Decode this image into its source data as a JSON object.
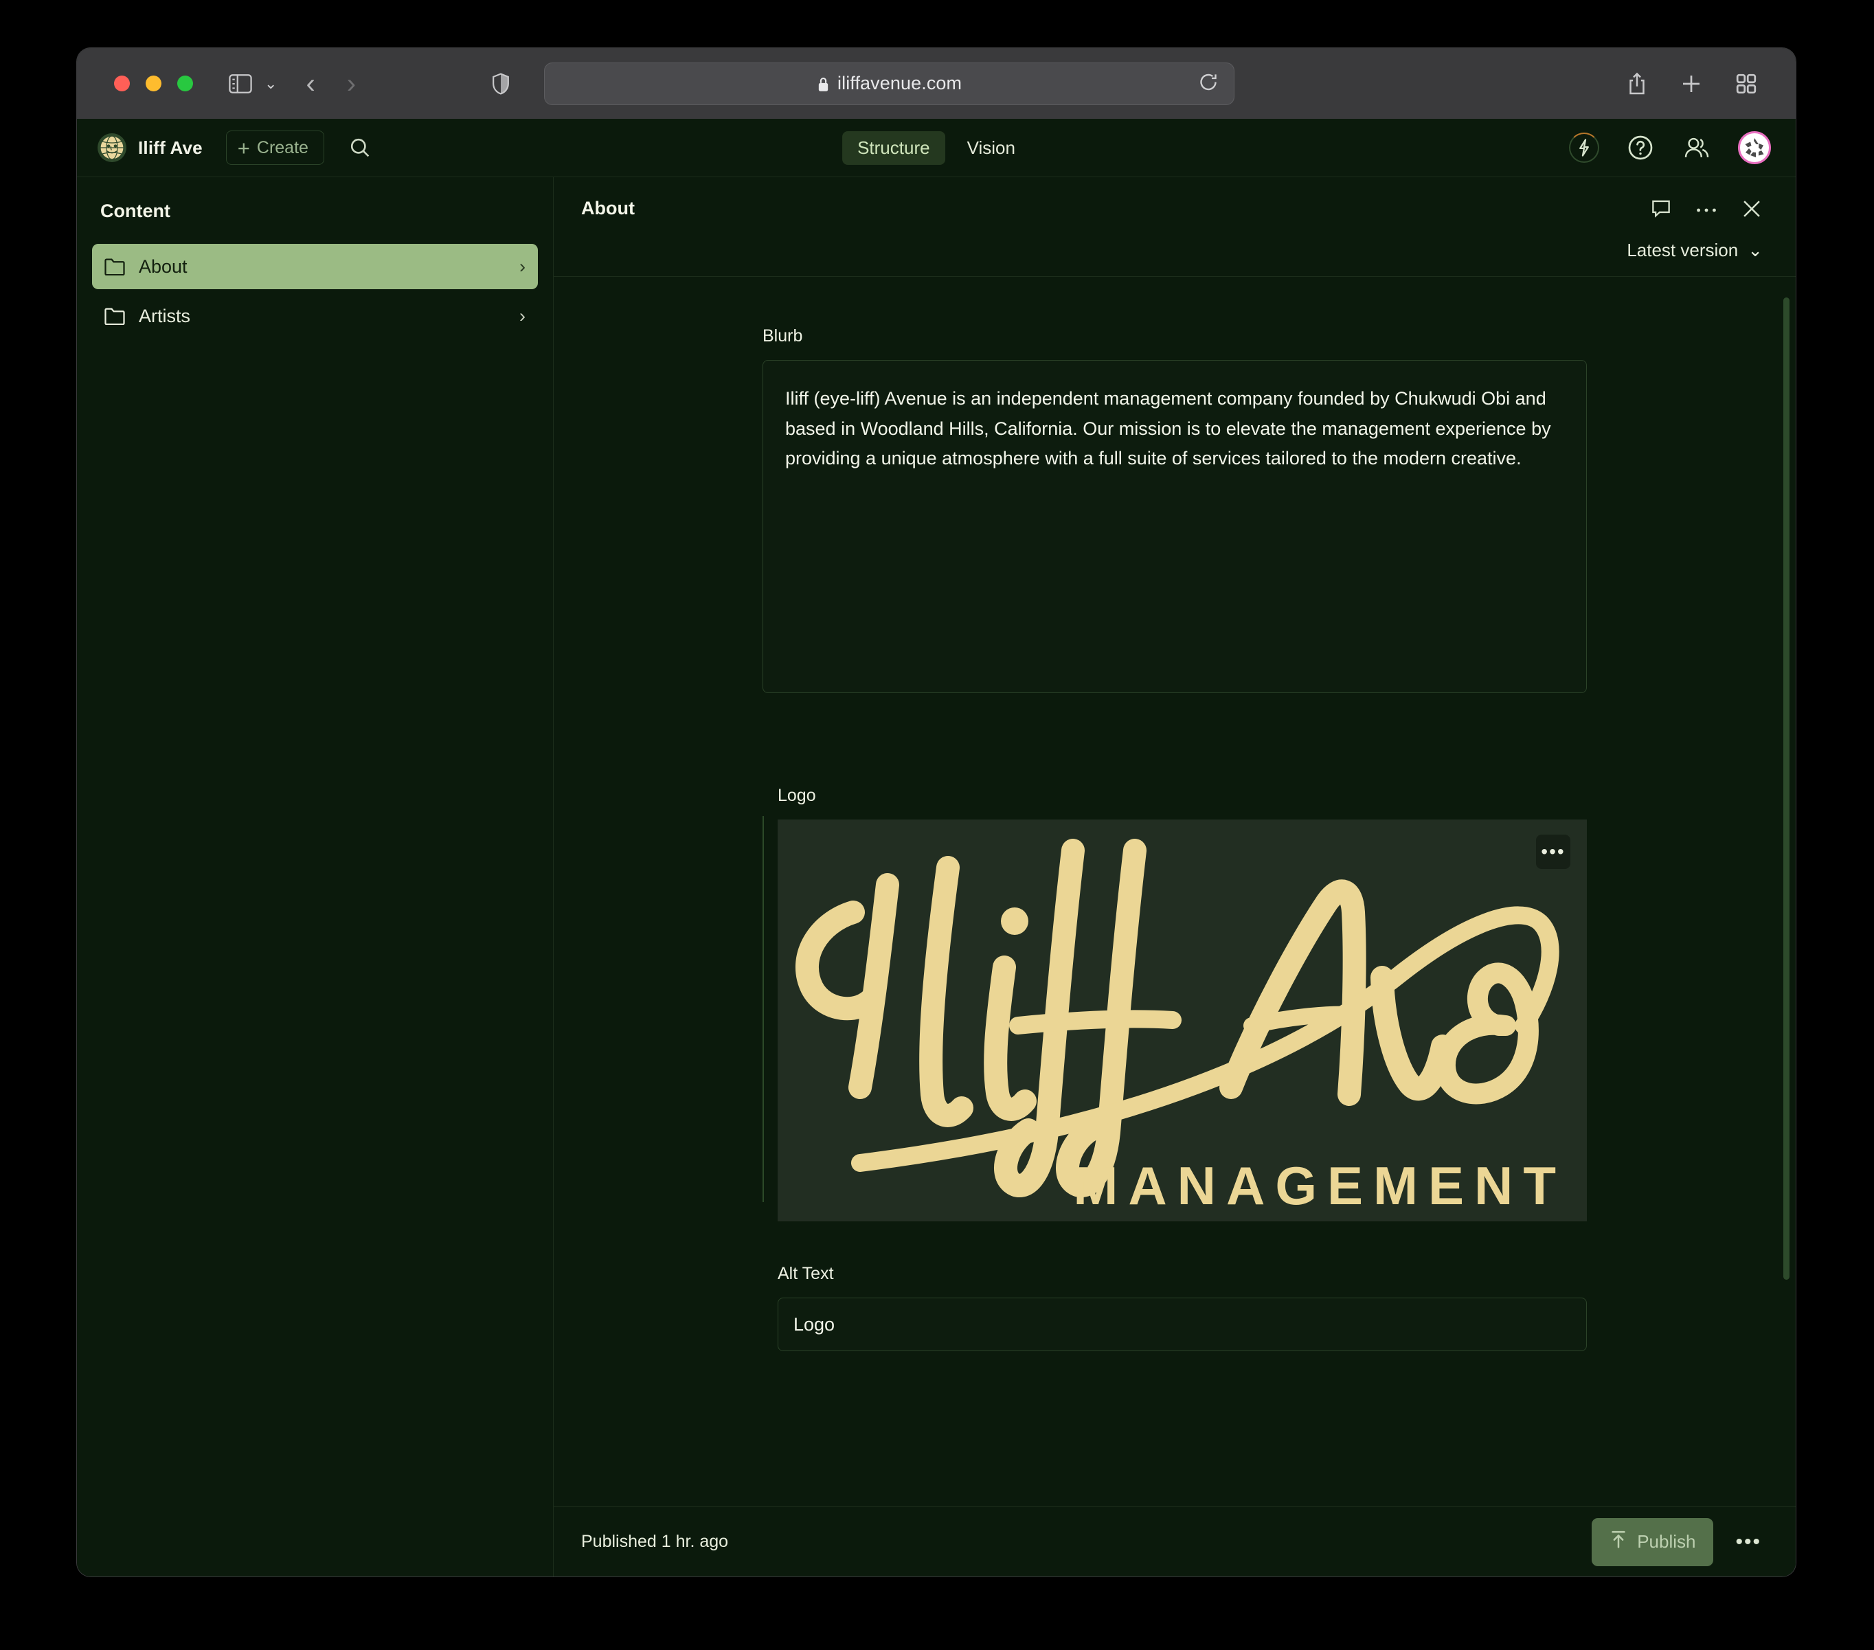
{
  "browser": {
    "url": "iliffavenue.com",
    "lock_icon": "lock-icon",
    "sidebar_toggle_icon": "sidebar-toggle-icon",
    "back_icon": "chevron-left-icon",
    "forward_icon": "chevron-right-icon",
    "shield_icon": "privacy-shield-icon",
    "reload_icon": "reload-icon",
    "share_icon": "share-icon",
    "new_tab_icon": "plus-icon",
    "tab_overview_icon": "tab-grid-icon"
  },
  "app_header": {
    "brand_name": "Iliff Ave",
    "brand_logo_icon": "globe-face-logo-icon",
    "create_label": "Create",
    "create_plus": "+",
    "search_icon": "search-icon",
    "tabs": [
      {
        "label": "Structure",
        "active": true
      },
      {
        "label": "Vision",
        "active": false
      }
    ],
    "right_icons": [
      {
        "name": "lightning-bolt-icon"
      },
      {
        "name": "help-question-icon"
      },
      {
        "name": "members-users-icon"
      },
      {
        "name": "user-avatar"
      }
    ]
  },
  "sidebar": {
    "title": "Content",
    "items": [
      {
        "label": "About",
        "icon": "folder-icon",
        "chevron": "›",
        "selected": true
      },
      {
        "label": "Artists",
        "icon": "folder-icon",
        "chevron": "›",
        "selected": false
      }
    ]
  },
  "document": {
    "title": "About",
    "comment_icon": "comment-icon",
    "more_icon": "ellipsis-icon",
    "close_icon": "close-icon",
    "version_label": "Latest version",
    "version_chevron": "⌄"
  },
  "fields": {
    "blurb": {
      "label": "Blurb",
      "value": "Iliff (eye-liff) Avenue is an independent management company founded by Chukwudi Obi and based in Woodland Hills, California. Our mission is to elevate the management experience by providing a unique atmosphere with a full suite of services tailored to the modern creative."
    },
    "logo": {
      "label": "Logo",
      "overlay_more": "•••",
      "script_text": "Iliff Ave",
      "wordmark_text": "MANAGEMENT",
      "image_bg": "#222e22",
      "image_fg": "#ebd695"
    },
    "alt_text": {
      "label": "Alt Text",
      "value": "Logo",
      "placeholder": "Alt text"
    }
  },
  "footer": {
    "published": "Published 1 hr. ago",
    "publish_label": "Publish",
    "publish_icon": "upload-icon",
    "more_label": "•••"
  },
  "colors": {
    "app_bg": "#0b1a0c",
    "accent_green": "#9bbb84",
    "tab_active_bg": "#24381f",
    "publish_bg": "#54704a",
    "avatar_ring": "#e86fc0",
    "logo_cream": "#ebd695"
  }
}
